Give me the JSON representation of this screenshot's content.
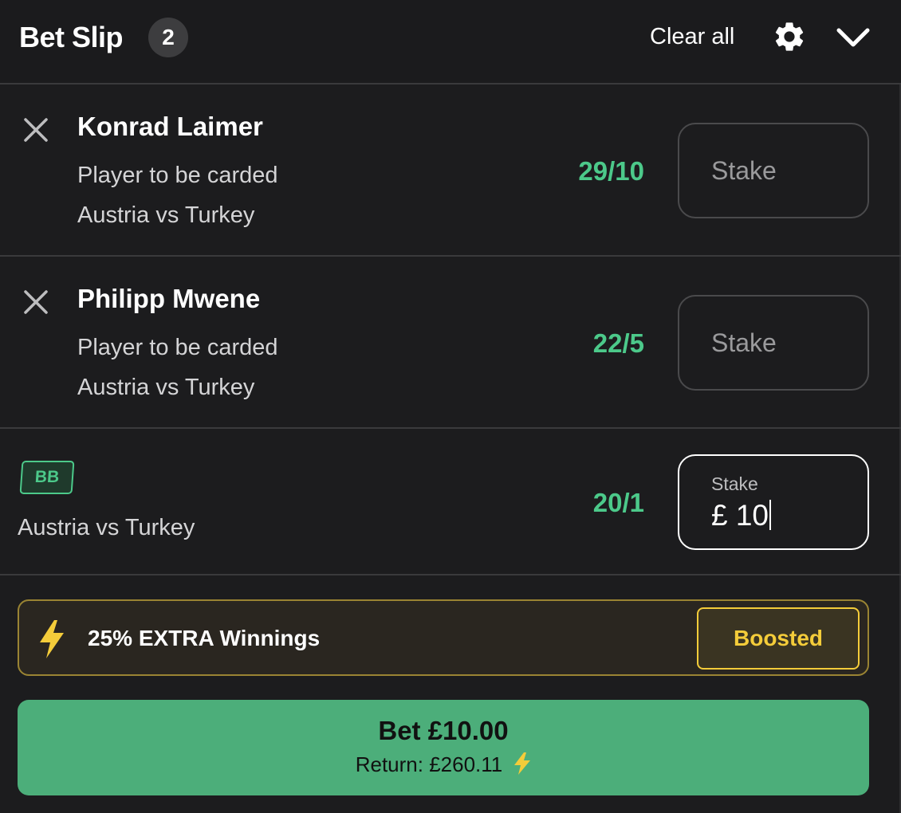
{
  "header": {
    "title": "Bet Slip",
    "count": "2",
    "clear_all": "Clear all",
    "settings_icon": "gear-icon",
    "collapse_icon": "chevron-down-icon"
  },
  "selections": [
    {
      "name": "Konrad Laimer",
      "market": "Player to be carded",
      "event": "Austria vs Turkey",
      "odds": "29/10",
      "stake_placeholder": "Stake"
    },
    {
      "name": "Philipp Mwene",
      "market": "Player to be carded",
      "event": "Austria vs Turkey",
      "odds": "22/5",
      "stake_placeholder": "Stake"
    }
  ],
  "bet_builder": {
    "badge": "BB",
    "event": "Austria vs Turkey",
    "odds": "20/1",
    "stake_label": "Stake",
    "stake_value": "£ 10"
  },
  "boost": {
    "text": "25% EXTRA Winnings",
    "button_label": "Boosted",
    "icon": "lightning-bolt-icon"
  },
  "bet_button": {
    "label": "Bet £10.00",
    "return_text": "Return: £260.11"
  },
  "colors": {
    "odds_green": "#4cc98a",
    "bet_button_green": "#4cae7a",
    "boost_yellow": "#f4cc3a",
    "background": "#1c1c1e"
  }
}
